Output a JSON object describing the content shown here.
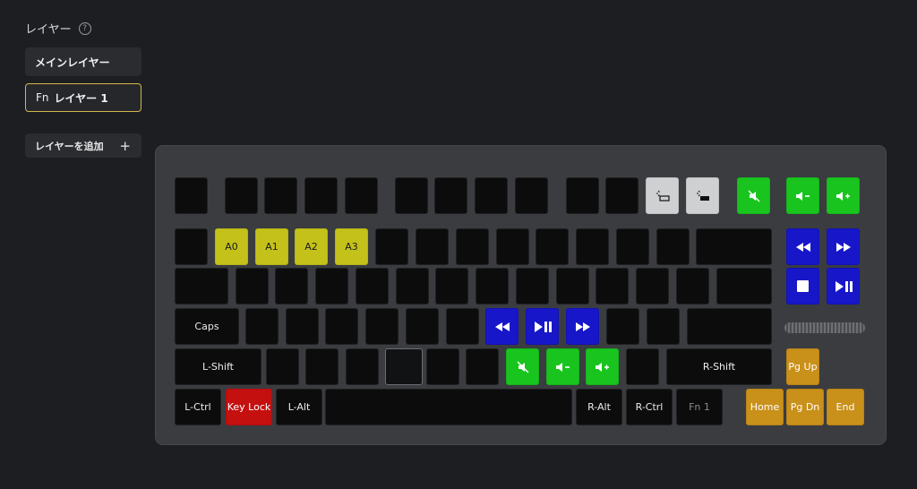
{
  "sidebar": {
    "title": "レイヤー",
    "help_icon": "?",
    "layers": [
      {
        "label": "メインレイヤー"
      },
      {
        "prefix": "Fn",
        "label": "レイヤー 1"
      }
    ],
    "add_layer": "レイヤーを追加",
    "add_icon": "+"
  },
  "keyboard": {
    "labels": {
      "a0": "A0",
      "a1": "A1",
      "a2": "A2",
      "a3": "A3",
      "caps": "Caps",
      "lshift": "L-Shift",
      "rshift": "R-Shift",
      "lctrl": "L-Ctrl",
      "keylock": "Key Lock",
      "lalt": "L-Alt",
      "ralt": "R-Alt",
      "rctrl": "R-Ctrl",
      "fn1": "Fn 1",
      "pgup": "Pg Up",
      "home": "Home",
      "pgdn": "Pg Dn",
      "end": "End"
    },
    "colors": {
      "yellow": "#c4c21a",
      "green": "#19c41f",
      "blue": "#1717c9",
      "gray": "#cfd0d2",
      "red": "#c51010",
      "orange": "#c9901a"
    }
  }
}
